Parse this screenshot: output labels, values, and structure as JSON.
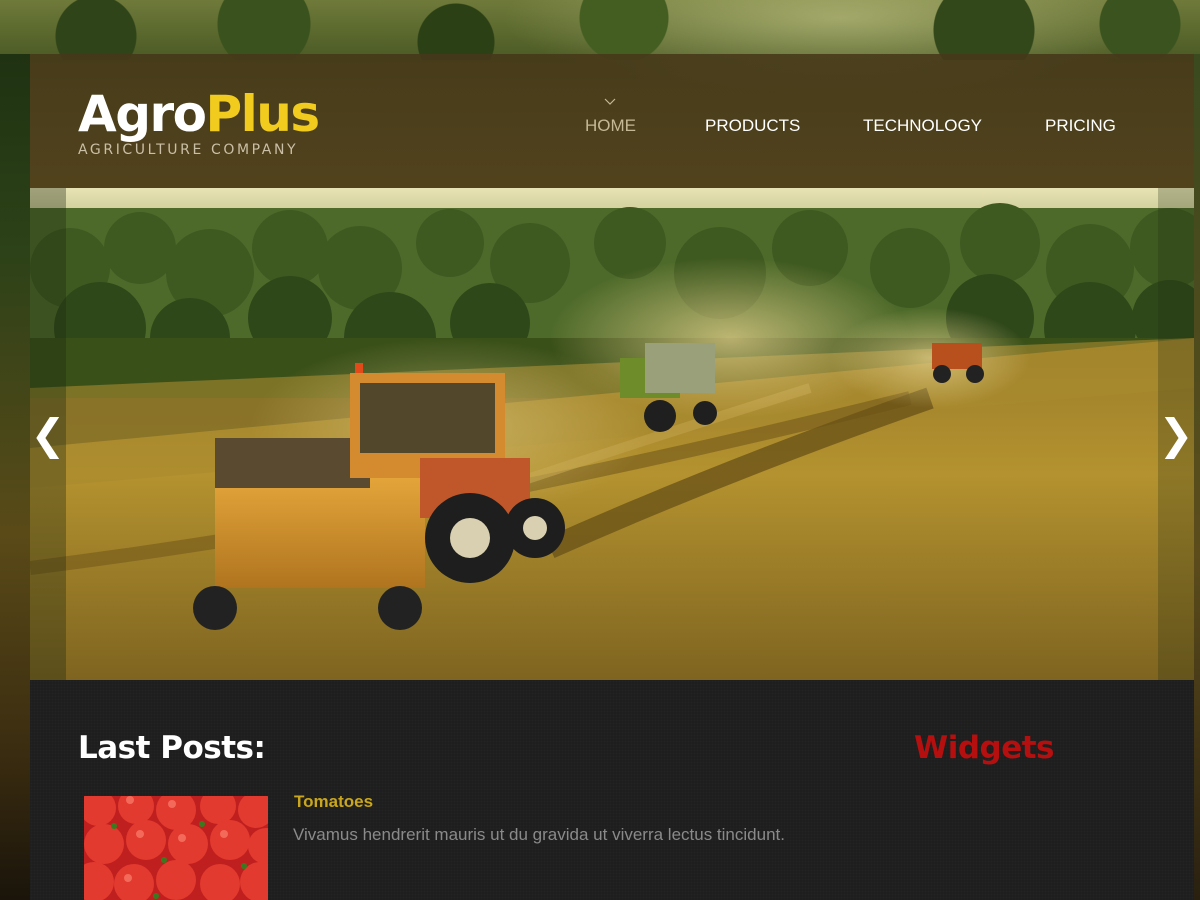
{
  "brand": {
    "name_part1": "Agro",
    "name_part2": "Plus",
    "tagline": "AGRICULTURE COMPANY"
  },
  "nav": {
    "items": [
      {
        "label": "HOME",
        "active": true
      },
      {
        "label": "PRODUCTS",
        "active": false
      },
      {
        "label": "TECHNOLOGY",
        "active": false
      },
      {
        "label": "PRICING",
        "active": false
      }
    ]
  },
  "slider": {
    "prev_glyph": "❮",
    "next_glyph": "❯"
  },
  "content": {
    "posts_heading": "Last Posts:",
    "widgets_heading": "Widgets",
    "posts": [
      {
        "title": "Tomatoes",
        "excerpt": "Vivamus hendrerit mauris ut du gravida ut viverra lectus tincidunt."
      }
    ]
  },
  "colors": {
    "accent_yellow": "#f1cc1e",
    "post_title": "#c9a61d",
    "widgets_red": "#b50f0f",
    "content_bg": "#1e1e1e"
  },
  "icons": {
    "prev": "chevron-left-icon",
    "next": "chevron-right-icon",
    "active_nav_marker": "caret-down-icon"
  }
}
